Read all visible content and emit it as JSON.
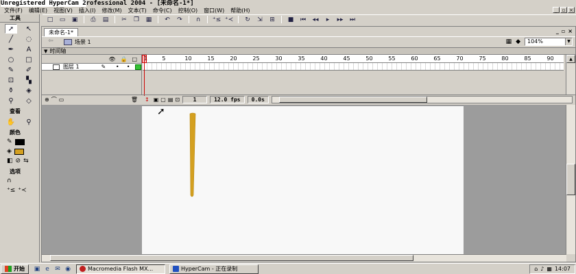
{
  "app": {
    "watermark": "Unregistered HyperCam 2",
    "window_title": "rofessional 2004 - [未命名-1*]"
  },
  "menu": {
    "items": [
      "文件(F)",
      "编辑(E)",
      "视图(V)",
      "插入(I)",
      "修改(M)",
      "文本(T)",
      "命令(C)",
      "控制(O)",
      "窗口(W)",
      "帮助(H)"
    ]
  },
  "tools": {
    "title": "工具",
    "view_label": "查看",
    "colors_label": "颜色",
    "options_label": "选项",
    "stroke_color": "#000000",
    "fill_color": "#d4a020"
  },
  "document": {
    "tab_label": "未命名-1*",
    "scene_label": "场景 1",
    "zoom_value": "104%"
  },
  "timeline": {
    "header_label": "时间轴",
    "layer_name": "图层 1",
    "ruler": [
      "1",
      "5",
      "10",
      "15",
      "20",
      "25",
      "30",
      "35",
      "40",
      "45",
      "50",
      "55",
      "60",
      "65",
      "70",
      "75",
      "80",
      "85",
      "90"
    ],
    "current_frame": "1",
    "fps": "12.0 fps",
    "time": "0.0s"
  },
  "stage": {
    "background": "#f8f8f8",
    "stroke_color": "#d4a020"
  },
  "taskbar": {
    "start_label": "开始",
    "tasks": [
      "Macromedia Flash MX...",
      "HyperCam - 正在录制"
    ],
    "clock": "14:07"
  }
}
